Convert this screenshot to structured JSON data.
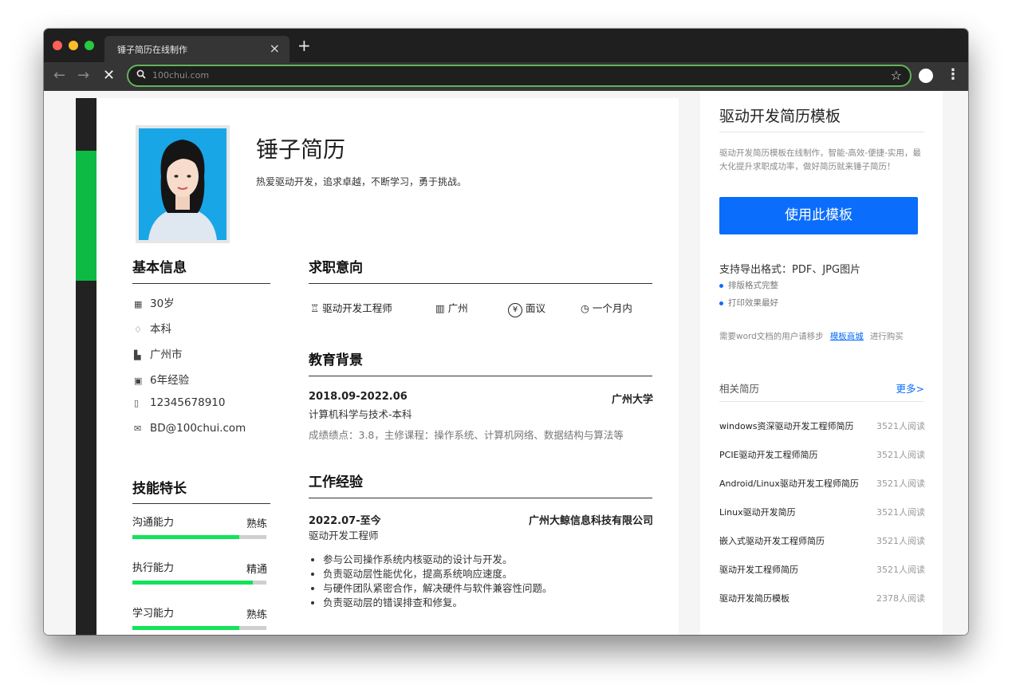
{
  "browser": {
    "tab_title": "锤子简历在线制作",
    "close_tab": "×",
    "new_tab": "+",
    "url_placeholder": "100chui.com",
    "traffic_colors": [
      "#ff5f57",
      "#febc2e",
      "#28c840"
    ]
  },
  "resume": {
    "name": "锤子简历",
    "motto": "热爱驱动开发，追求卓越，不断学习，勇于挑战。",
    "basic_info_title": "基本信息",
    "basic_info": [
      {
        "icon": "calendar-icon",
        "glyph": "▦",
        "text": "30岁"
      },
      {
        "icon": "graduation-icon",
        "glyph": "♢",
        "text": "本科"
      },
      {
        "icon": "building-icon",
        "glyph": "▙",
        "text": "广州市"
      },
      {
        "icon": "briefcase-icon",
        "glyph": "▣",
        "text": "6年经验"
      },
      {
        "icon": "phone-icon",
        "glyph": "▯",
        "text": "12345678910"
      },
      {
        "icon": "mail-icon",
        "glyph": "✉",
        "text": "BD@100chui.com"
      }
    ],
    "skills_title": "技能特长",
    "skills": [
      {
        "label": "沟通能力",
        "level": "熟练",
        "fill": 0.8
      },
      {
        "label": "执行能力",
        "level": "精通",
        "fill": 0.9
      },
      {
        "label": "学习能力",
        "level": "熟练",
        "fill": 0.8
      }
    ],
    "intent_title": "求职意向",
    "intent": [
      {
        "icon": "tie-icon",
        "glyph": "♖",
        "text": "驱动开发工程师"
      },
      {
        "icon": "city-icon",
        "glyph": "▥",
        "text": "广州"
      },
      {
        "icon": "yen-icon",
        "glyph": "¥",
        "text": "面议"
      },
      {
        "icon": "clock-icon",
        "glyph": "◷",
        "text": "一个月内"
      }
    ],
    "education_title": "教育背景",
    "education": {
      "dates": "2018.09-2022.06",
      "school": "广州大学",
      "major": "计算机科学与技术-本科",
      "details": "成绩绩点：3.8，主修课程：操作系统、计算机网络、数据结构与算法等"
    },
    "work_title": "工作经验",
    "work": {
      "dates": "2022.07-至今",
      "company": "广州大鲸信息科技有限公司",
      "role": "驱动开发工程师",
      "bullets": [
        "参与公司操作系统内核驱动的设计与开发。",
        "负责驱动层性能优化，提高系统响应速度。",
        "与硬件团队紧密合作，解决硬件与软件兼容性问题。",
        "负责驱动层的错误排查和修复。"
      ]
    }
  },
  "sidebar": {
    "title": "驱动开发简历模板",
    "description": "驱动开发简历模板在线制作，智能-高效-便捷-实用，最大化提升求职成功率，做好简历就来锤子简历！",
    "use_button": "使用此模板",
    "export_formats": "支持导出格式：PDF、JPG图片",
    "features": [
      "排版格式完整",
      "打印效果最好"
    ],
    "word_note_prefix": "需要word文档的用户请移步",
    "word_note_link": "模板商城",
    "word_note_suffix": "进行购买",
    "related_title": "相关简历",
    "more_link": "更多>",
    "related": [
      {
        "title": "windows资深驱动开发工程师简历",
        "reads": "3521人阅读"
      },
      {
        "title": "PCIE驱动开发工程师简历",
        "reads": "3521人阅读"
      },
      {
        "title": "Android/Linux驱动开发工程师简历",
        "reads": "3521人阅读"
      },
      {
        "title": "Linux驱动开发简历",
        "reads": "3521人阅读"
      },
      {
        "title": "嵌入式驱动开发工程师简历",
        "reads": "3521人阅读"
      },
      {
        "title": "驱动开发工程师简历",
        "reads": "3521人阅读"
      },
      {
        "title": "驱动开发简历模板",
        "reads": "2378人阅读"
      }
    ]
  }
}
